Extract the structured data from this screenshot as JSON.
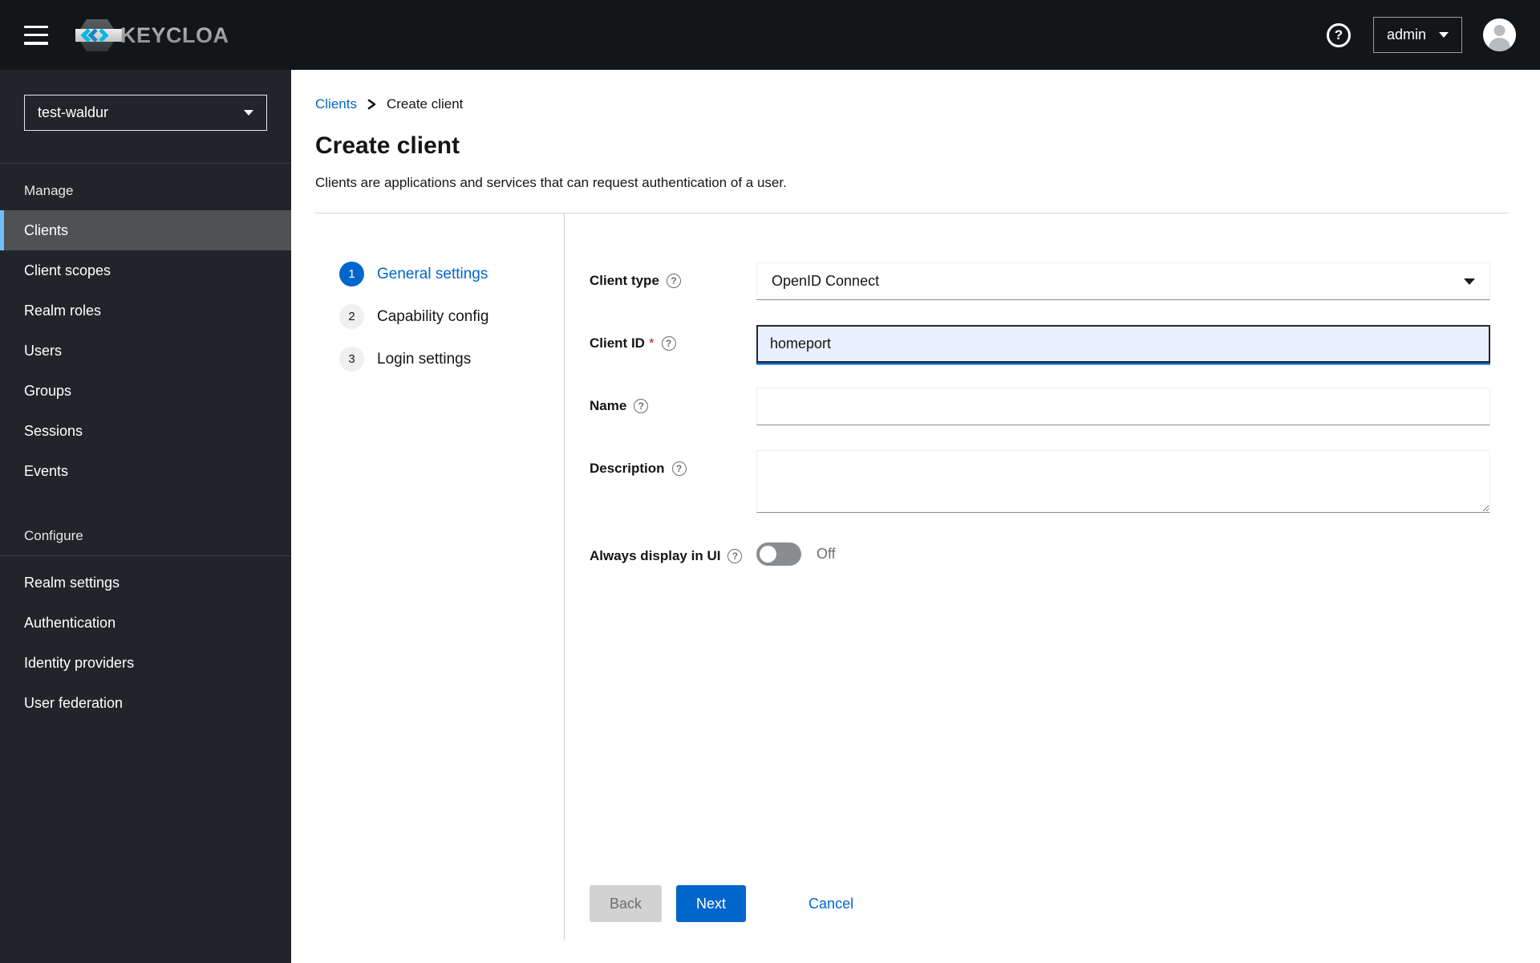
{
  "header": {
    "brand": "KEYCLOAK",
    "help_glyph": "?",
    "user_menu": {
      "label": "admin"
    }
  },
  "sidebar": {
    "realm_selector": {
      "value": "test-waldur"
    },
    "sections": [
      {
        "label": "Manage",
        "items": [
          {
            "label": "Clients",
            "active": true
          },
          {
            "label": "Client scopes",
            "active": false
          },
          {
            "label": "Realm roles",
            "active": false
          },
          {
            "label": "Users",
            "active": false
          },
          {
            "label": "Groups",
            "active": false
          },
          {
            "label": "Sessions",
            "active": false
          },
          {
            "label": "Events",
            "active": false
          }
        ]
      },
      {
        "label": "Configure",
        "items": [
          {
            "label": "Realm settings",
            "active": false
          },
          {
            "label": "Authentication",
            "active": false
          },
          {
            "label": "Identity providers",
            "active": false
          },
          {
            "label": "User federation",
            "active": false
          }
        ]
      }
    ]
  },
  "breadcrumb": {
    "items": [
      {
        "label": "Clients",
        "link": true
      },
      {
        "label": "Create client",
        "link": false
      }
    ]
  },
  "page": {
    "title": "Create client",
    "description": "Clients are applications and services that can request authentication of a user."
  },
  "wizard": {
    "steps": [
      {
        "number": "1",
        "label": "General settings",
        "active": true
      },
      {
        "number": "2",
        "label": "Capability config",
        "active": false
      },
      {
        "number": "3",
        "label": "Login settings",
        "active": false
      }
    ]
  },
  "form": {
    "help_glyph": "?",
    "client_type": {
      "label": "Client type",
      "value": "OpenID Connect"
    },
    "client_id": {
      "label": "Client ID",
      "required_mark": "*",
      "value": "homeport"
    },
    "name": {
      "label": "Name",
      "value": ""
    },
    "description": {
      "label": "Description",
      "value": ""
    },
    "always_display": {
      "label": "Always display in UI",
      "state": "Off"
    }
  },
  "actions": {
    "back": "Back",
    "next": "Next",
    "cancel": "Cancel"
  },
  "colors": {
    "primary": "#0066cc",
    "header_bg": "#131619",
    "sidebar_bg": "#212529",
    "active_item_bg": "#4f5255",
    "active_item_border": "#73bcf7",
    "autofill_bg": "#e8f0fe",
    "disabled_button_bg": "#d2d2d2",
    "required_red": "#c9190b"
  }
}
